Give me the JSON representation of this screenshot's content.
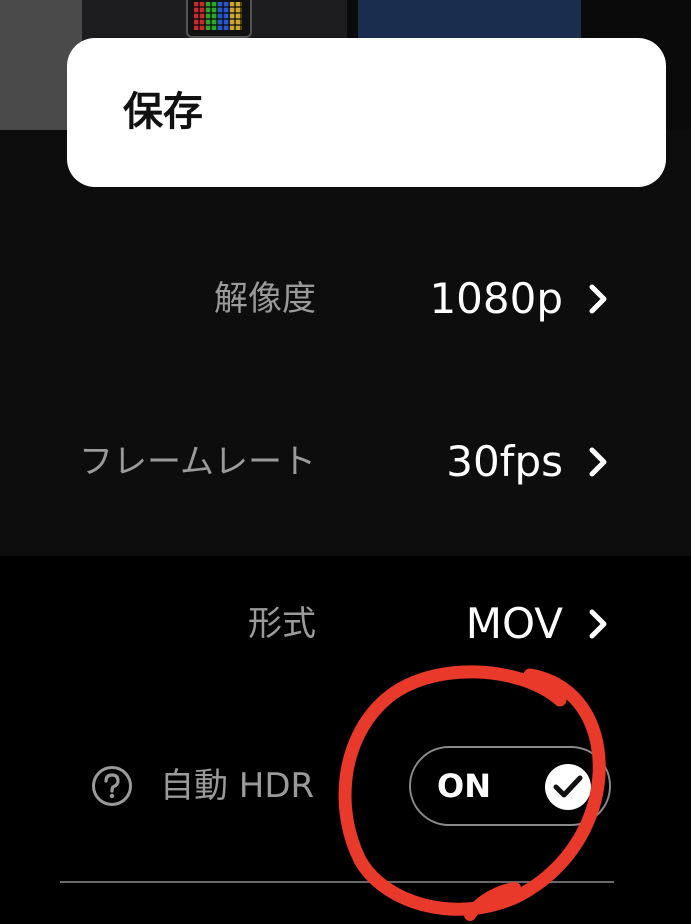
{
  "save_card": {
    "label": "保存"
  },
  "settings": {
    "resolution": {
      "label": "解像度",
      "value": "1080p"
    },
    "frame_rate": {
      "label": "フレームレート",
      "value": "30fps"
    },
    "format": {
      "label": "形式",
      "value": "MOV"
    },
    "auto_hdr": {
      "label": "自動 HDR",
      "toggle_text": "ON",
      "enabled": true
    }
  },
  "colors": {
    "background": "#000000",
    "card": "#ffffff",
    "muted_text": "#9a9a9a",
    "annotation": "#e8392b"
  },
  "icons": {
    "chevron": "chevron-right-icon",
    "help": "question-circle-icon",
    "check": "checkmark-icon"
  }
}
